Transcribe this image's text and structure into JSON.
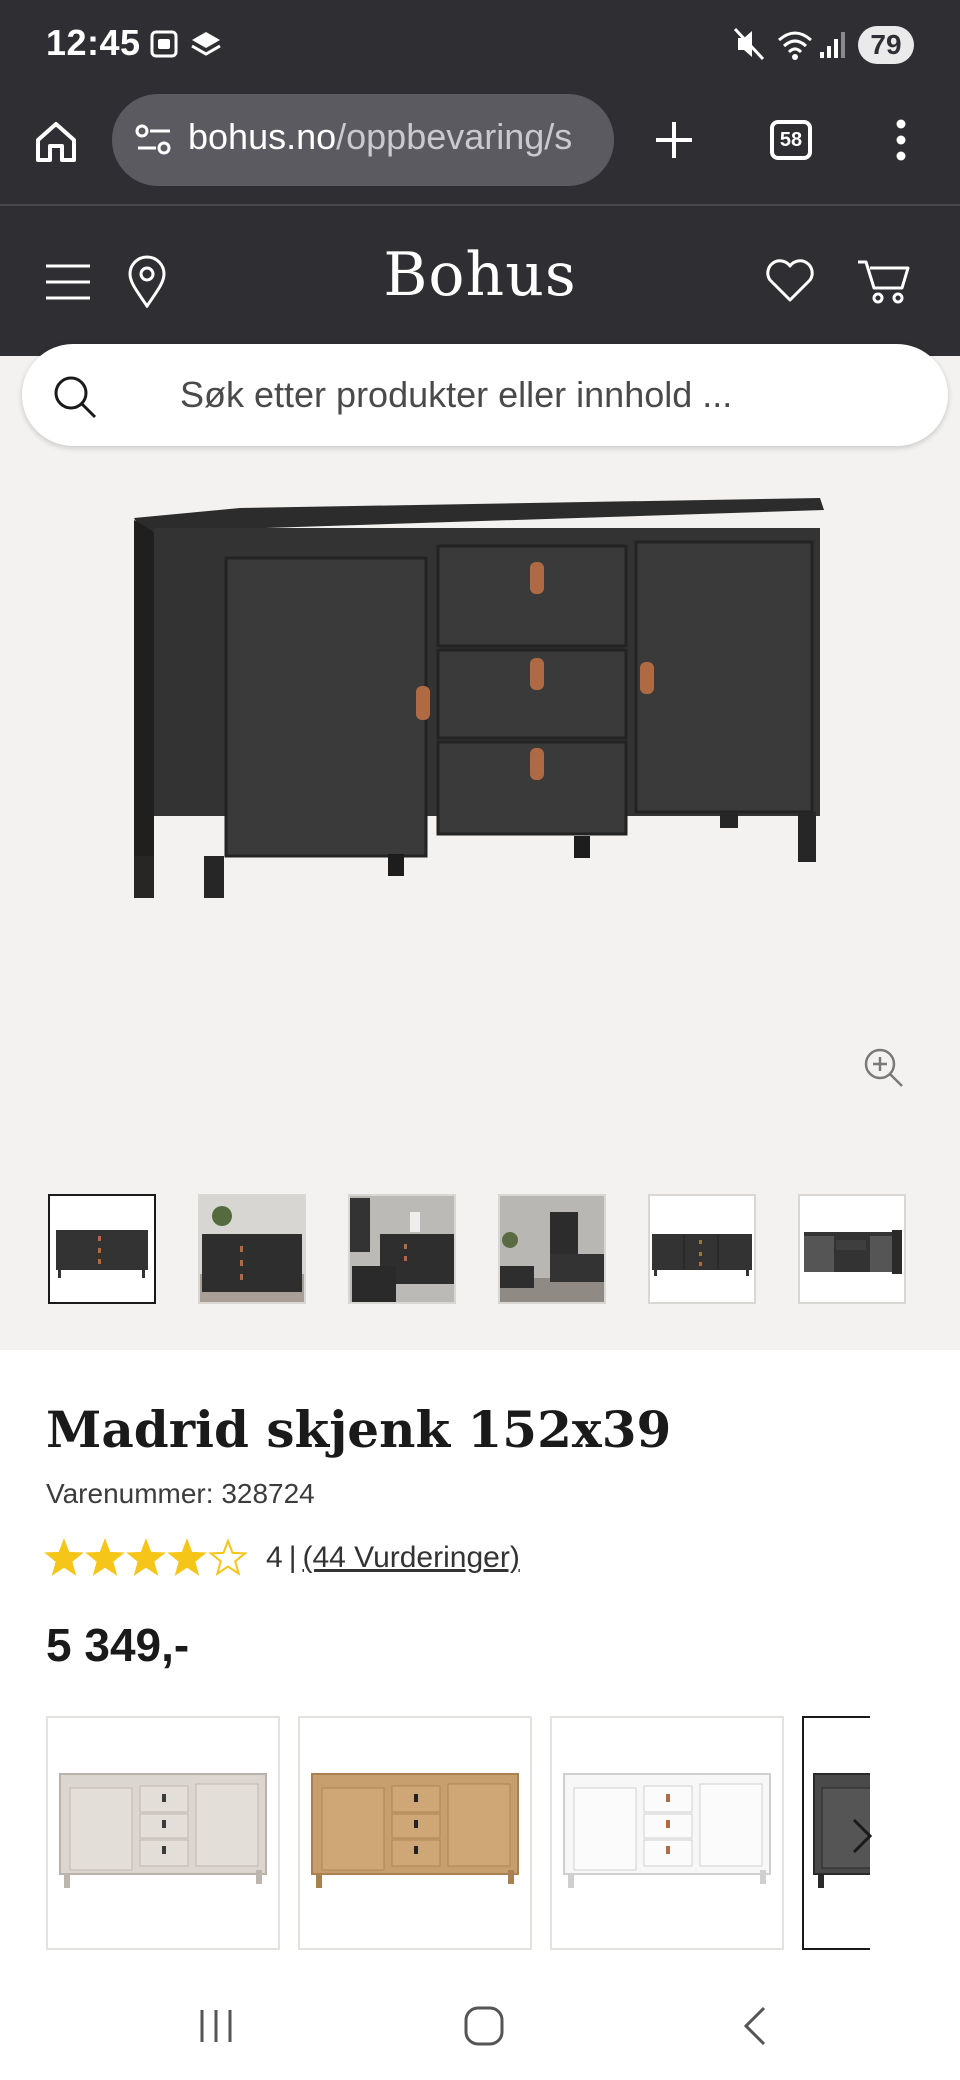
{
  "status_bar": {
    "time": "12:45",
    "battery": "79",
    "icons": [
      "screenshot-icon",
      "stack-icon",
      "mute-icon",
      "wifi-icon",
      "signal-icon"
    ]
  },
  "browser": {
    "url_domain": "bohus.no",
    "url_path": "/oppbevaring/s",
    "tab_count": "58",
    "icons": [
      "home-icon",
      "site-info-icon",
      "new-tab-icon",
      "tabs-icon",
      "more-menu-icon"
    ]
  },
  "site_header": {
    "logo": "Bohus",
    "search_placeholder": "Søk etter produkter eller innhold ...",
    "icons": [
      "menu-icon",
      "location-icon",
      "wishlist-heart-icon",
      "cart-icon",
      "search-icon"
    ]
  },
  "gallery": {
    "thumbnails": [
      "Main product",
      "Room 1",
      "Room 2",
      "Room 3",
      "Front view",
      "Open view"
    ],
    "selected_index": 0
  },
  "product": {
    "title": "Madrid skjenk 152x39",
    "sku_label": "Varenummer: 328724",
    "rating_value": 4,
    "rating_max": 5,
    "rating_score": "4",
    "rating_separator": "|",
    "reviews_link": "(44 Vurderinger)",
    "price": "5 349,-"
  },
  "variants": {
    "colors": [
      "#dcd6d0",
      "#c79f6f",
      "#f7f7f7",
      "#3a3a3a"
    ]
  },
  "colors": {
    "header_bg": "#2f2f33",
    "star": "#f5c518",
    "gallery_bg": "#f3f2f0",
    "leather": "#b06a43"
  }
}
